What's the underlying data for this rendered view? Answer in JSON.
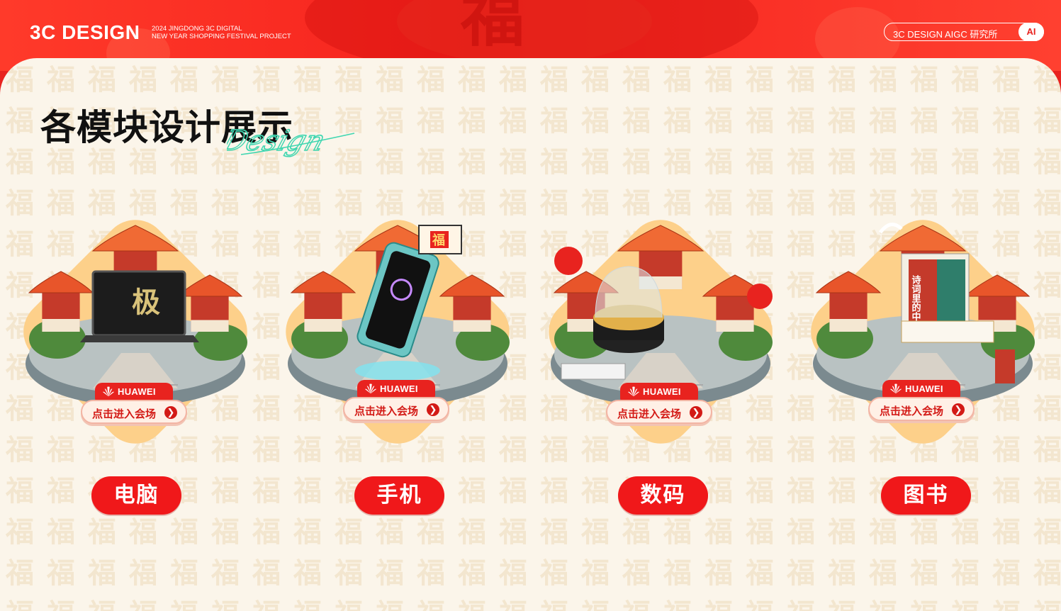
{
  "header": {
    "logo": "3C DESIGN",
    "subtitle_line1": "2024 JINGDONG 3C DIGITAL",
    "subtitle_line2": "NEW YEAR SHOPPING FESTIVAL PROJECT",
    "lab_label": "3C DESIGN AIGC 研究所",
    "ai_label": "AI",
    "decor_glyph": "福"
  },
  "section": {
    "title": "各模块设计展示",
    "script_word": "Design"
  },
  "pattern_glyph": "福",
  "modules": [
    {
      "label": "电脑",
      "brand": "HUAWEI",
      "cta": "点击进入会场",
      "screen_text": "极",
      "arrow": "❯"
    },
    {
      "label": "手机",
      "brand": "HUAWEI",
      "cta": "点击进入会场",
      "screen_text": "福",
      "arrow": "❯"
    },
    {
      "label": "数码",
      "brand": "HUAWEI",
      "cta": "点击进入会场",
      "screen_text": "",
      "arrow": "❯"
    },
    {
      "label": "图书",
      "brand": "HUAWEI",
      "cta": "点击进入会场",
      "screen_text": "诗词里的中国",
      "arrow": "❯"
    }
  ],
  "colors": {
    "brand_red": "#f0181a",
    "panel_bg": "#fbf5ea",
    "diamond": "#fdd08a",
    "roof": "#e8552a"
  }
}
